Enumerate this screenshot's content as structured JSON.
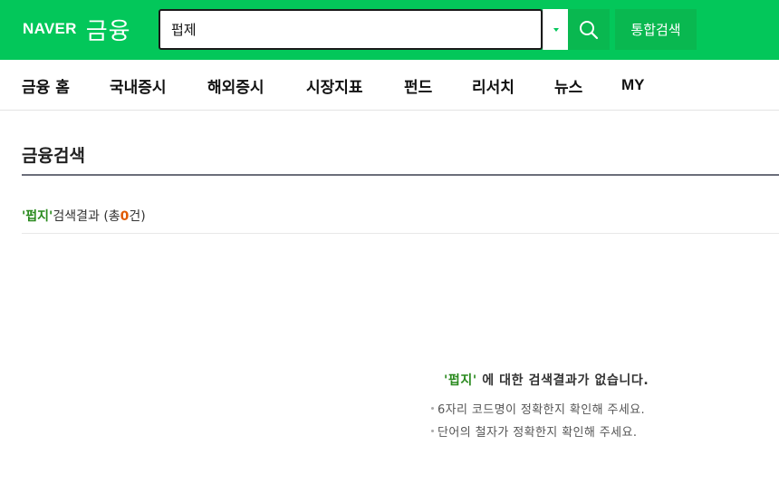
{
  "header": {
    "logo_brand": "NAVER",
    "logo_service": "금융",
    "search_value": "펍제",
    "total_search_label": "통합검색"
  },
  "nav": {
    "items": [
      {
        "label": "금융 홈"
      },
      {
        "label": "국내증시"
      },
      {
        "label": "해외증시"
      },
      {
        "label": "시장지표"
      },
      {
        "label": "펀드"
      },
      {
        "label": "리서치"
      },
      {
        "label": "뉴스"
      },
      {
        "label": "MY"
      }
    ]
  },
  "section": {
    "title": "금융검색"
  },
  "result": {
    "keyword": "'펍지'",
    "text": "검색결과 (총",
    "count": "0",
    "suffix": "건)"
  },
  "empty": {
    "keyword": "'펍지'",
    "message": " 에 대한 검색결과가 없습니다.",
    "hints": [
      "6자리 코드명이 정확한지 확인해 주세요.",
      "단어의 철자가 정확한지 확인해 주세요."
    ]
  },
  "colors": {
    "brand_green": "#03c75a",
    "keyword_green": "#2a8a1e",
    "count_orange": "#e05a00"
  }
}
